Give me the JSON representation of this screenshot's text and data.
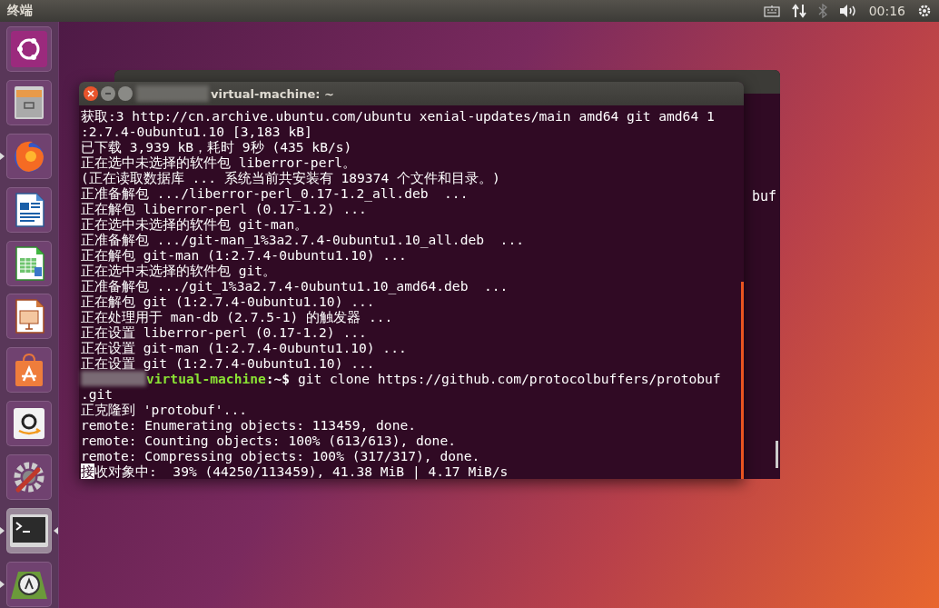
{
  "top_bar": {
    "app_title": "终端",
    "clock": "00:16"
  },
  "launcher": {
    "items": [
      {
        "kind": "dash",
        "running": false,
        "focused": false
      },
      {
        "kind": "files",
        "running": false,
        "focused": false
      },
      {
        "kind": "browser",
        "running": true,
        "focused": false
      },
      {
        "kind": "writer",
        "running": false,
        "focused": false
      },
      {
        "kind": "calc",
        "running": false,
        "focused": false
      },
      {
        "kind": "impress",
        "running": false,
        "focused": false
      },
      {
        "kind": "store",
        "running": false,
        "focused": false
      },
      {
        "kind": "shop",
        "running": false,
        "focused": false
      },
      {
        "kind": "settings",
        "running": false,
        "focused": false
      },
      {
        "kind": "terminal",
        "running": true,
        "focused": true
      },
      {
        "kind": "updater",
        "running": true,
        "focused": false
      }
    ]
  },
  "back_window": {
    "visible_text": "buf"
  },
  "terminal": {
    "title": "virtual-machine: ~",
    "lines": [
      {
        "kind": "output",
        "text": "获取:3 http://cn.archive.ubuntu.com/ubuntu xenial-updates/main amd64 git amd64 1"
      },
      {
        "kind": "output",
        "text": ":2.7.4-0ubuntu1.10 [3,183 kB]"
      },
      {
        "kind": "output",
        "text": "已下载 3,939 kB，耗时 9秒 (435 kB/s)"
      },
      {
        "kind": "output",
        "text": "正在选中未选择的软件包 liberror-perl。"
      },
      {
        "kind": "output",
        "text": "(正在读取数据库 ... 系统当前共安装有 189374 个文件和目录。)"
      },
      {
        "kind": "output",
        "text": "正准备解包 .../liberror-perl_0.17-1.2_all.deb  ..."
      },
      {
        "kind": "output",
        "text": "正在解包 liberror-perl (0.17-1.2) ..."
      },
      {
        "kind": "output",
        "text": "正在选中未选择的软件包 git-man。"
      },
      {
        "kind": "output",
        "text": "正准备解包 .../git-man_1%3a2.7.4-0ubuntu1.10_all.deb  ..."
      },
      {
        "kind": "output",
        "text": "正在解包 git-man (1:2.7.4-0ubuntu1.10) ..."
      },
      {
        "kind": "output",
        "text": "正在选中未选择的软件包 git。"
      },
      {
        "kind": "output",
        "text": "正准备解包 .../git_1%3a2.7.4-0ubuntu1.10_amd64.deb  ..."
      },
      {
        "kind": "output",
        "text": "正在解包 git (1:2.7.4-0ubuntu1.10) ..."
      },
      {
        "kind": "output",
        "text": "正在处理用于 man-db (2.7.5-1) 的触发器 ..."
      },
      {
        "kind": "output",
        "text": "正在设置 liberror-perl (0.17-1.2) ..."
      },
      {
        "kind": "output",
        "text": "正在设置 git-man (1:2.7.4-0ubuntu1.10) ..."
      },
      {
        "kind": "output",
        "text": "正在设置 git (1:2.7.4-0ubuntu1.10) ..."
      },
      {
        "kind": "prompt",
        "host": "virtual-machine",
        "path": ":~$",
        "text": "git clone https://github.com/protocolbuffers/protobuf"
      },
      {
        "kind": "output",
        "text": ".git"
      },
      {
        "kind": "output",
        "text": "正克隆到 'protobuf'..."
      },
      {
        "kind": "output",
        "text": "remote: Enumerating objects: 113459, done."
      },
      {
        "kind": "output",
        "text": "remote: Counting objects: 100% (613/613), done."
      },
      {
        "kind": "output",
        "text": "remote: Compressing objects: 100% (317/317), done."
      },
      {
        "kind": "cursor",
        "cursor_text": "接",
        "text": "收对象中:  39% (44250/113459), 41.38 MiB | 4.17 MiB/s"
      }
    ]
  }
}
